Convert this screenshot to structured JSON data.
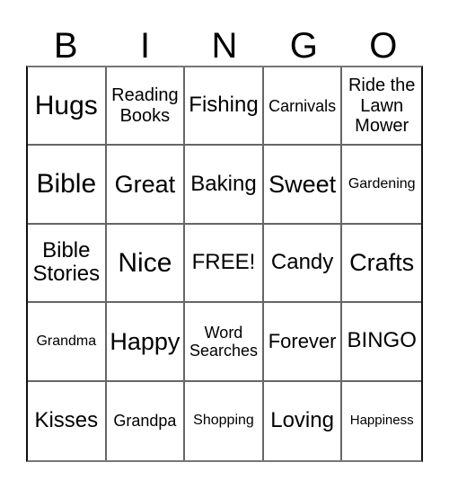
{
  "header": {
    "letters": [
      "B",
      "I",
      "N",
      "G",
      "O"
    ]
  },
  "card": {
    "rows": [
      [
        "Hugs",
        "Reading Books",
        "Fishing",
        "Carnivals",
        "Ride the Lawn Mower"
      ],
      [
        "Bible",
        "Great",
        "Baking",
        "Sweet",
        "Gardening"
      ],
      [
        "Bible Stories",
        "Nice",
        "FREE!",
        "Candy",
        "Crafts"
      ],
      [
        "Grandma",
        "Happy",
        "Word Searches",
        "Forever",
        "BINGO"
      ],
      [
        "Kisses",
        "Grandpa",
        "Shopping",
        "Loving",
        "Happiness"
      ]
    ],
    "free_space": "FREE!"
  },
  "colors": {
    "text": "#000000",
    "grid_line": "#666666",
    "outer_border": "#111111",
    "background": "#ffffff"
  }
}
